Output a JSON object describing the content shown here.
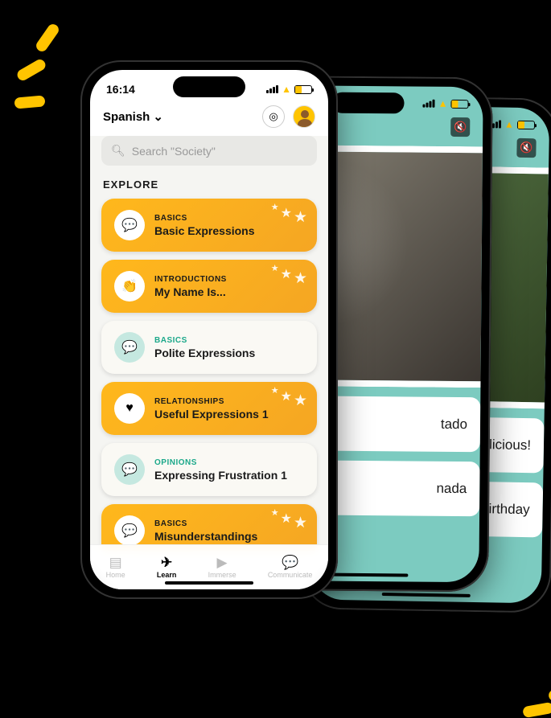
{
  "statusTime": "16:14",
  "language": "Spanish",
  "searchPlaceholder": "Search \"Society\"",
  "exploreHeading": "EXPLORE",
  "cards": [
    {
      "category": "BASICS",
      "title": "Basic Expressions",
      "icon": "speech-icon",
      "glyph": "💬",
      "theme": "gold",
      "stars": true
    },
    {
      "category": "INTRODUCTIONS",
      "title": "My Name Is...",
      "icon": "wave-icon",
      "glyph": "👏",
      "theme": "gold",
      "stars": true
    },
    {
      "category": "BASICS",
      "title": "Polite Expressions",
      "icon": "speech-icon",
      "glyph": "💬",
      "theme": "cream mint",
      "stars": false
    },
    {
      "category": "RELATIONSHIPS",
      "title": "Useful Expressions 1",
      "icon": "heart-icon",
      "glyph": "♥",
      "theme": "gold",
      "stars": true
    },
    {
      "category": "OPINIONS",
      "title": "Expressing Frustration 1",
      "icon": "speech-icon",
      "glyph": "💬",
      "theme": "cream mint",
      "stars": false
    },
    {
      "category": "BASICS",
      "title": "Misunderstandings",
      "icon": "speech-icon",
      "glyph": "💬",
      "theme": "gold",
      "stars": true
    }
  ],
  "tabs": [
    {
      "label": "Home",
      "icon": "home-icon",
      "glyph": "▤",
      "active": false
    },
    {
      "label": "Learn",
      "icon": "learn-icon",
      "glyph": "✈",
      "active": true
    },
    {
      "label": "Immerse",
      "icon": "immerse-icon",
      "glyph": "▶",
      "active": false
    },
    {
      "label": "Communicate",
      "icon": "communicate-icon",
      "glyph": "💬",
      "active": false
    }
  ],
  "phoneB": {
    "card1": "tado",
    "card2": "nada"
  },
  "phoneC": {
    "card1": "elicious!",
    "card2": "birthday"
  }
}
